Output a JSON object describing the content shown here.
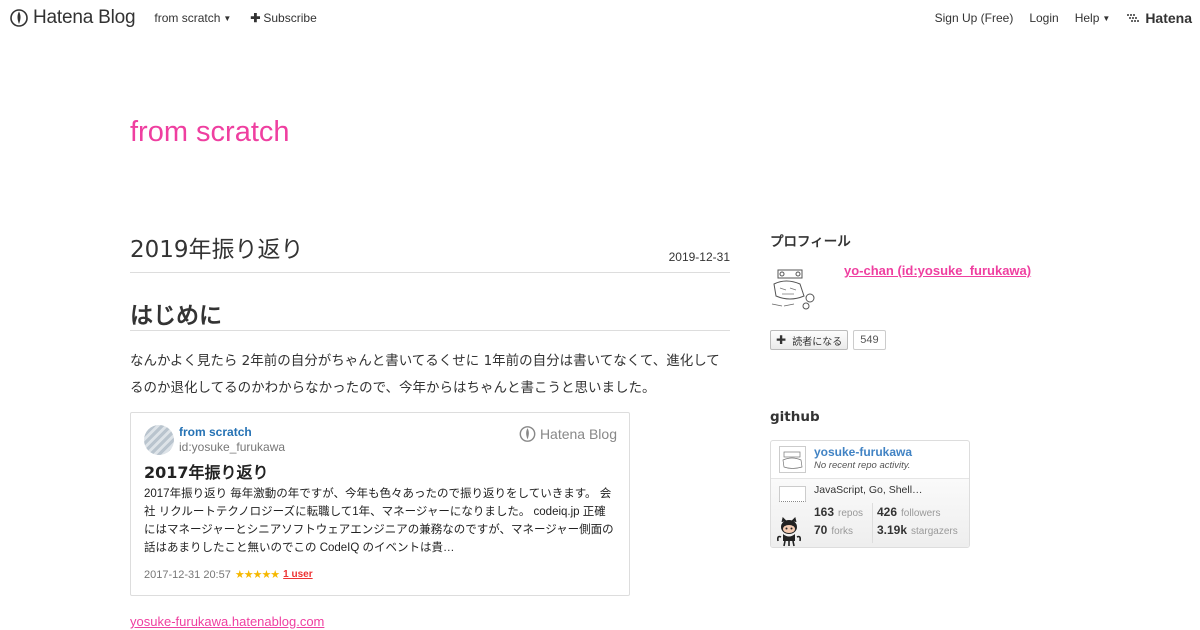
{
  "header": {
    "brand": "Hatena Blog",
    "blog_menu": "from scratch",
    "subscribe": "Subscribe",
    "signup": "Sign Up (Free)",
    "login": "Login",
    "help": "Help",
    "hatena": "Hatena"
  },
  "blog": {
    "title": "from scratch"
  },
  "entry": {
    "title": "2019年振り返り",
    "date": "2019-12-31",
    "heading": "はじめに",
    "paragraph": "なんかよく見たら 2年前の自分がちゃんと書いてるくせに 1年前の自分は書いてなくて、進化してるのか退化してるのかわからなかったので、今年からはちゃんと書こうと思いました。",
    "embed": {
      "blog_name": "from scratch",
      "author_id": "id:yosuke_furukawa",
      "logo_text": "Hatena Blog",
      "title": "2017年振り返り",
      "description": "2017年振り返り 毎年激動の年ですが、今年も色々あったので振り返りをしていきます。 会社 リクルートテクノロジーズに転職して1年、マネージャーになりました。 codeiq.jp 正確にはマネージャーとシニアソフトウェアエンジニアの兼務なのですが、マネージャー側面の話はあまりしたこと無いのでこの CodeIQ のイベントは貴…",
      "datetime": "2017-12-31 20:57",
      "stars": "★★★★★",
      "bookmark_users": "1 user"
    },
    "blog_url": "yosuke-furukawa.hatenablog.com"
  },
  "sidebar": {
    "profile": {
      "title": "プロフィール",
      "name": "yo-chan (id:yosuke_furukawa)",
      "subscribe_label": "読者になる",
      "subscriber_count": "549"
    },
    "github": {
      "title": "github",
      "username": "yosuke-furukawa",
      "activity": "No recent repo activity.",
      "languages": "JavaScript, Go, Shell…",
      "repos": "163",
      "repos_label": "repos",
      "forks": "70",
      "forks_label": "forks",
      "followers": "426",
      "followers_label": "followers",
      "stargazers": "3.19k",
      "stargazers_label": "stargazers"
    }
  },
  "colors": {
    "accent": "#ef3fa0",
    "link_blue": "#2572b4",
    "github_blue": "#4183c4"
  }
}
